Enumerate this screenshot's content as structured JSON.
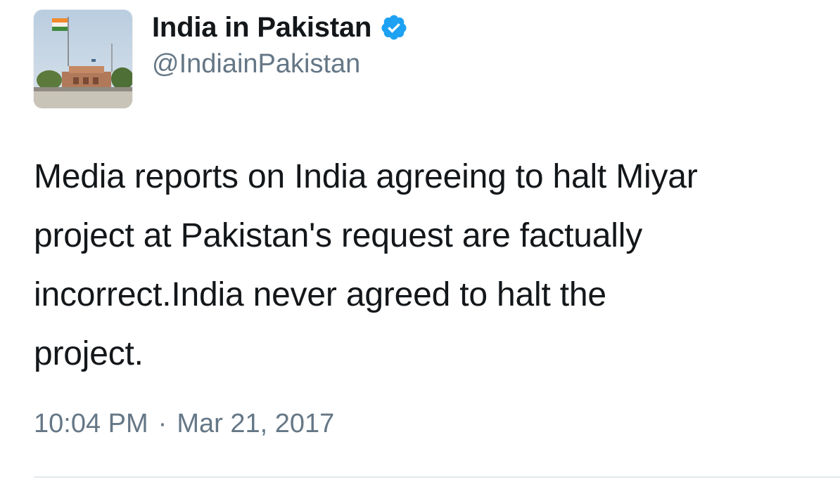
{
  "account": {
    "display_name": "India in Pakistan",
    "handle": "@IndiainPakistan",
    "verified": true,
    "verified_icon": "verified-badge-icon"
  },
  "tweet": {
    "text": "Media reports on India agreeing to halt Miyar\nproject at Pakistan's request  are factually\nincorrect.India never agreed to halt the\nproject.",
    "time": "10:04 PM",
    "separator": "·",
    "date": "Mar 21, 2017"
  },
  "colors": {
    "text": "#14171a",
    "secondary": "#657786",
    "verified": "#1da1f2",
    "divider": "#e1e8ed"
  }
}
